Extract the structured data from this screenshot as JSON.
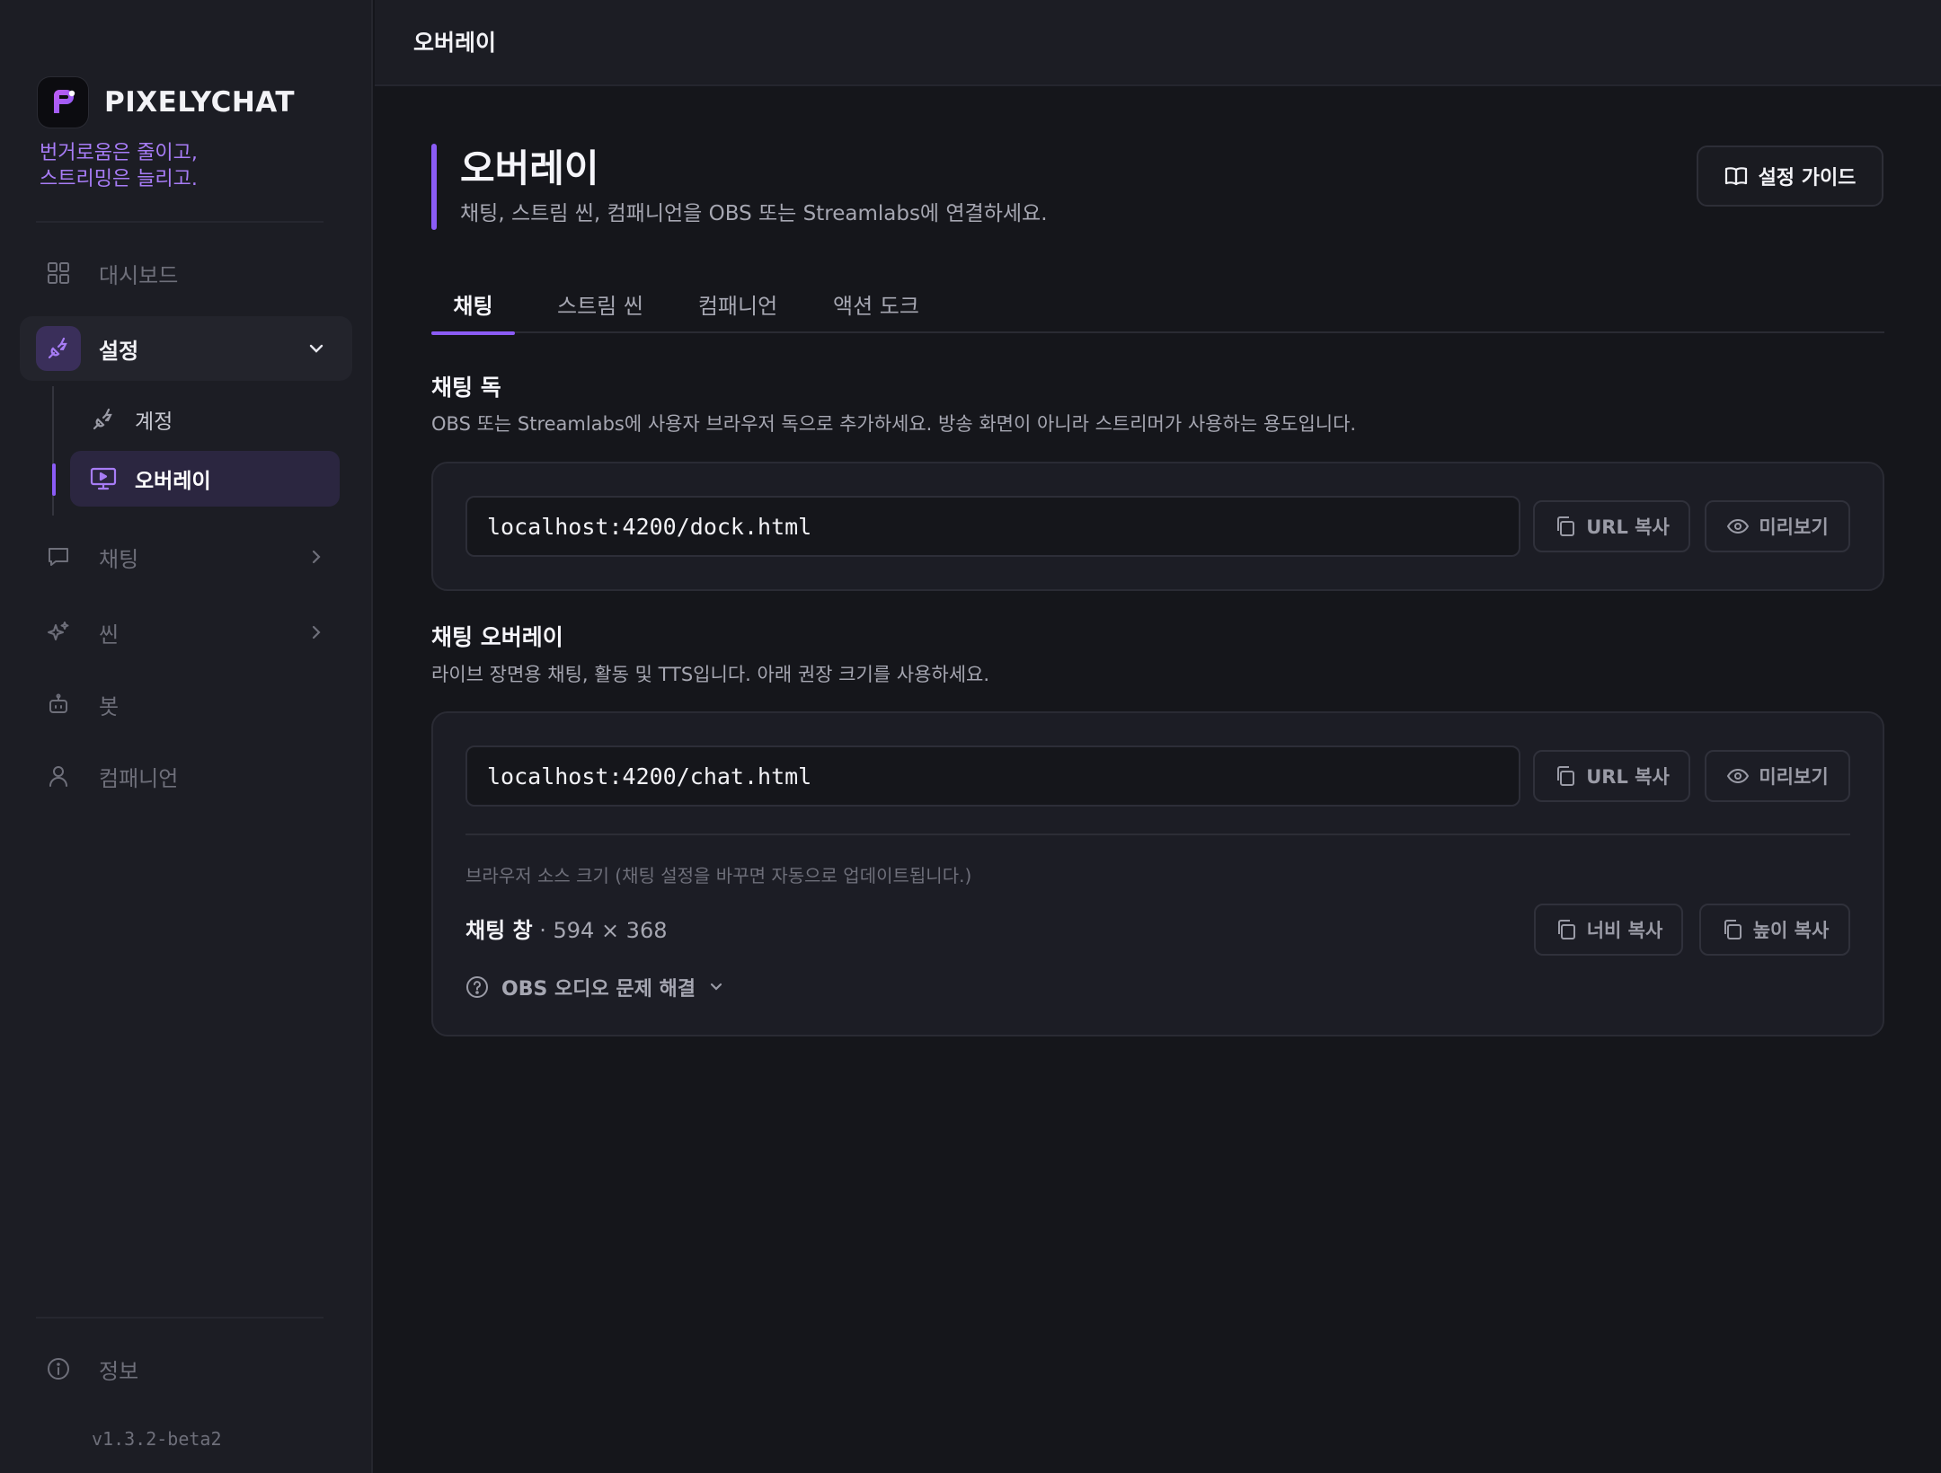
{
  "brand": {
    "name": "PIXELYCHAT",
    "tagline_lines": [
      "번거로움은 줄이고,",
      "스트리밍은 늘리고."
    ]
  },
  "sidebar": {
    "items": [
      {
        "label": "대시보드",
        "icon": "grid-icon"
      },
      {
        "label": "설정",
        "icon": "plug-icon"
      },
      {
        "label": "채팅",
        "icon": "chat-bubble-icon"
      },
      {
        "label": "씬",
        "icon": "sparkles-icon"
      },
      {
        "label": "봇",
        "icon": "robot-icon"
      },
      {
        "label": "컴패니언",
        "icon": "user-icon"
      }
    ],
    "settings_sub": [
      {
        "label": "계정",
        "icon": "plug-icon"
      },
      {
        "label": "오버레이",
        "icon": "monitor-icon"
      }
    ],
    "info_label": "정보",
    "version": "v1.3.2-beta2"
  },
  "topbar": {
    "title": "오버레이"
  },
  "page": {
    "title": "오버레이",
    "subtitle": "채팅, 스트림 씬, 컴패니언을 OBS 또는 Streamlabs에 연결하세요.",
    "guide_button": "설정 가이드"
  },
  "tabs": [
    {
      "label": "채팅",
      "active": true
    },
    {
      "label": "스트림 씬",
      "active": false
    },
    {
      "label": "컴패니언",
      "active": false
    },
    {
      "label": "액션 도크",
      "active": false
    }
  ],
  "dock": {
    "title": "채팅 독",
    "description": "OBS 또는 Streamlabs에 사용자 브라우저 독으로 추가하세요. 방송 화면이 아니라 스트리머가 사용하는 용도입니다.",
    "url": "localhost:4200/dock.html",
    "copy_label": "URL 복사",
    "preview_label": "미리보기"
  },
  "overlay": {
    "title": "채팅 오버레이",
    "description": "라이브 장면용 채팅, 활동 및 TTS입니다. 아래 권장 크기를 사용하세요.",
    "url": "localhost:4200/chat.html",
    "copy_label": "URL 복사",
    "preview_label": "미리보기",
    "size_hint": "브라우저 소스 크기 (채팅 설정을 바꾸면 자동으로 업데이트됩니다.)",
    "window_label": "채팅 창",
    "window_size": "· 594 × 368",
    "copy_width_label": "너비 복사",
    "copy_height_label": "높이 복사",
    "troubleshoot_label": "OBS 오디오 문제 해결"
  },
  "colors": {
    "accent": "#8b5cf6",
    "background": "#15161b",
    "sidebar": "#1c1d24"
  }
}
